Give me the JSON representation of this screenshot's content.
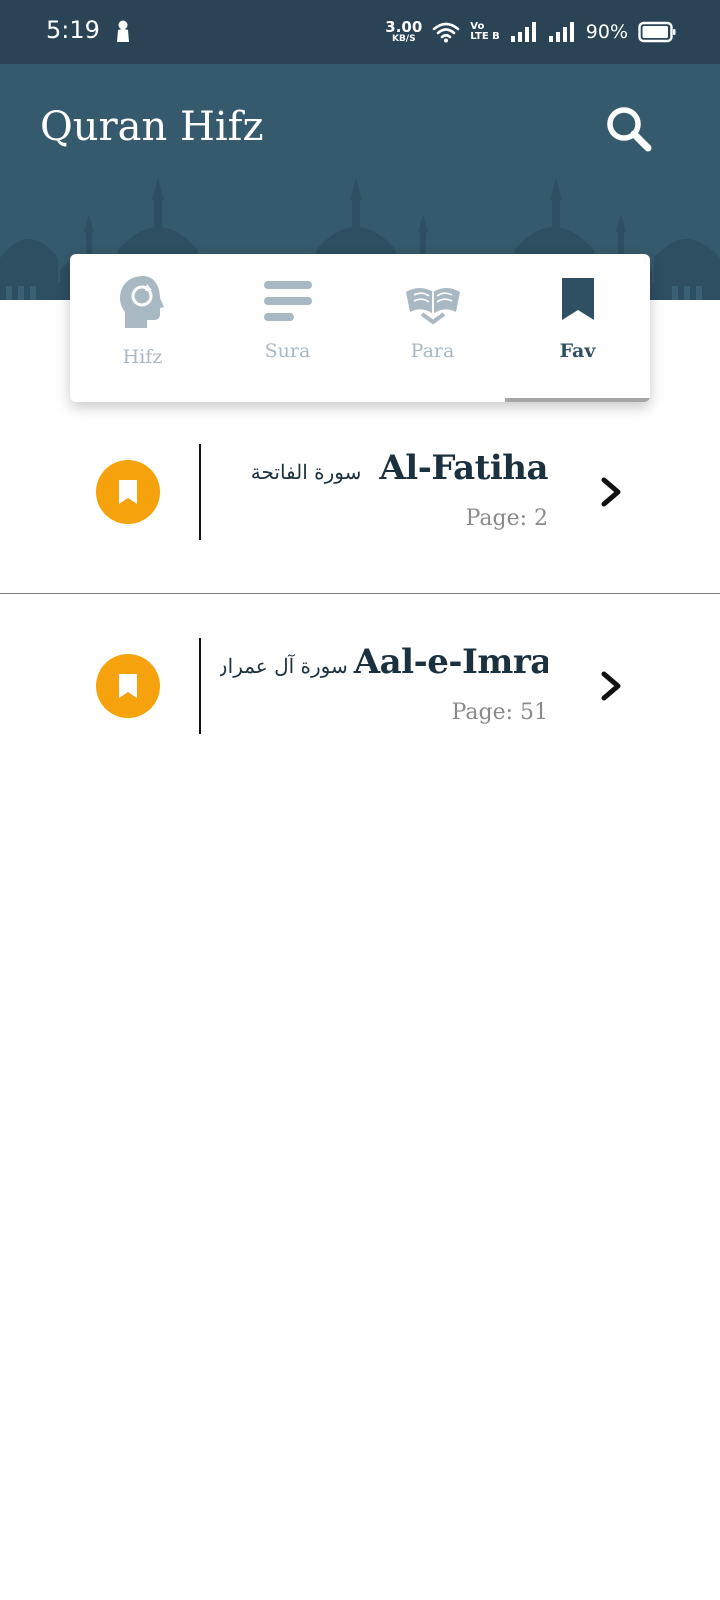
{
  "status_bar": {
    "time": "5:19",
    "net_speed_value": "3.00",
    "net_speed_unit": "KB/S",
    "volte_top": "Vo",
    "volte_bottom": "LTE B",
    "battery_percent": "90%"
  },
  "header": {
    "title": "Quran Hifz",
    "search_icon": "search-icon",
    "background_color": "#365a6d"
  },
  "tabs": [
    {
      "label": "Hifz",
      "icon": "head-refresh-icon",
      "active": false
    },
    {
      "label": "Sura",
      "icon": "lines-icon",
      "active": false
    },
    {
      "label": "Para",
      "icon": "open-book-icon",
      "active": false
    },
    {
      "label": "Fav",
      "icon": "bookmark-icon",
      "active": true
    }
  ],
  "favorites": [
    {
      "name": "Al-Fatiha",
      "arabic": "سورة الفاتحة",
      "page": "Page: 2"
    },
    {
      "name": "Aal-e-Imran",
      "arabic": "سورة آل عمران",
      "page": "Page: 51"
    }
  ],
  "colors": {
    "accent_orange": "#f6a20c",
    "tab_active": "#2f4f63",
    "tab_inactive": "#a9b9c4"
  }
}
